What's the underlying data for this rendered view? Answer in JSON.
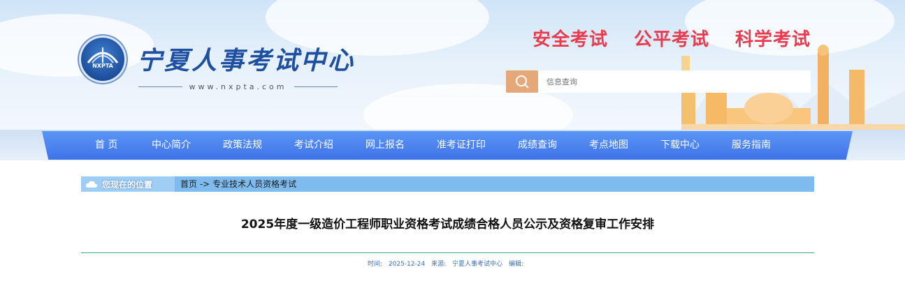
{
  "header": {
    "logo_text": "NXPTA",
    "site_name": "宁夏人事考试中心",
    "site_url": "www.nxpta.com",
    "slogans": [
      "安全考试",
      "公平考试",
      "科学考试"
    ],
    "search_placeholder": "信息查询",
    "search_icon": "search-icon"
  },
  "nav": {
    "items": [
      "首 页",
      "中心简介",
      "政策法规",
      "考试介绍",
      "网上报名",
      "准考证打印",
      "成绩查询",
      "考点地图",
      "下载中心",
      "服务指南"
    ]
  },
  "location": {
    "label": "您现在的位置",
    "crumbs": [
      "首页",
      "->",
      "专业技术人员资格考试"
    ]
  },
  "article": {
    "title": "2025年度一级造价工程师职业资格考试成绩合格人员公示及资格复审工作安排",
    "meta": {
      "time_label": "时间:",
      "time_value": "2025-12-24",
      "source_label": "来源:",
      "source_value": "宁夏人事考试中心",
      "editor_label": "编辑:"
    }
  },
  "colors": {
    "nav_bg": "#4a82ee",
    "slogan": "#e83b4d",
    "site_name": "#1f4fa0",
    "location_bar": "#7ebcf0",
    "divider": "#38a6a5",
    "meta_text": "#3c6fb6"
  }
}
